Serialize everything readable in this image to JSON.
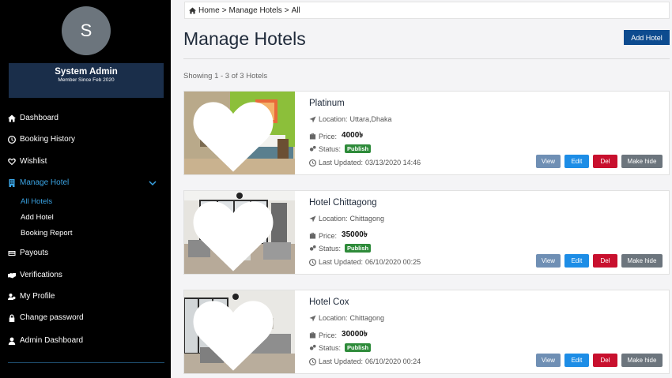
{
  "sidebar": {
    "avatar_letter": "S",
    "profile_name": "System Admin",
    "member_since": "Member Since Feb 2020",
    "items": [
      {
        "label": "Dashboard",
        "icon": "home-icon"
      },
      {
        "label": "Booking History",
        "icon": "clock-icon"
      },
      {
        "label": "Wishlist",
        "icon": "heart-icon"
      },
      {
        "label": "Manage Hotel",
        "icon": "building-icon",
        "active": true
      },
      {
        "label": "Payouts",
        "icon": "card-icon"
      },
      {
        "label": "Verifications",
        "icon": "handshake-icon"
      },
      {
        "label": "My Profile",
        "icon": "users-cog-icon"
      },
      {
        "label": "Change password",
        "icon": "lock-icon"
      },
      {
        "label": "Admin Dashboard",
        "icon": "user-icon"
      }
    ],
    "submenu": [
      {
        "label": "All Hotels",
        "active": true
      },
      {
        "label": "Add Hotel"
      },
      {
        "label": "Booking Report"
      }
    ]
  },
  "breadcrumb": {
    "home": "Home",
    "sep": ">",
    "section": "Manage Hotels",
    "current": "All"
  },
  "header": {
    "title": "Manage Hotels",
    "add_button": "Add Hotel"
  },
  "showing": "Showing 1 - 3 of 3 Hotels",
  "labels": {
    "location": "Location:",
    "price": "Price:",
    "status": "Status:",
    "updated": "Last Updated:"
  },
  "actions": {
    "view": "View",
    "edit": "Edit",
    "del": "Del",
    "hide": "Make hide"
  },
  "hotels": [
    {
      "name": "Platinum",
      "location": "Uttara,Dhaka",
      "price": "4000৳",
      "status": "Publish",
      "updated": "03/13/2020 14:46"
    },
    {
      "name": "Hotel Chittagong",
      "location": "Chittagong",
      "price": "35000৳",
      "status": "Publish",
      "updated": "06/10/2020 00:25"
    },
    {
      "name": "Hotel Cox",
      "location": "Chittagong",
      "price": "30000৳",
      "status": "Publish",
      "updated": "06/10/2020 00:24"
    }
  ],
  "colors": {
    "sidebar_bg": "#000000",
    "profile_bg": "#1a2e4a",
    "accent": "#3aa3e3",
    "primary": "#0d4b8f",
    "badge": "#2e8b3a",
    "del": "#c8102e"
  }
}
